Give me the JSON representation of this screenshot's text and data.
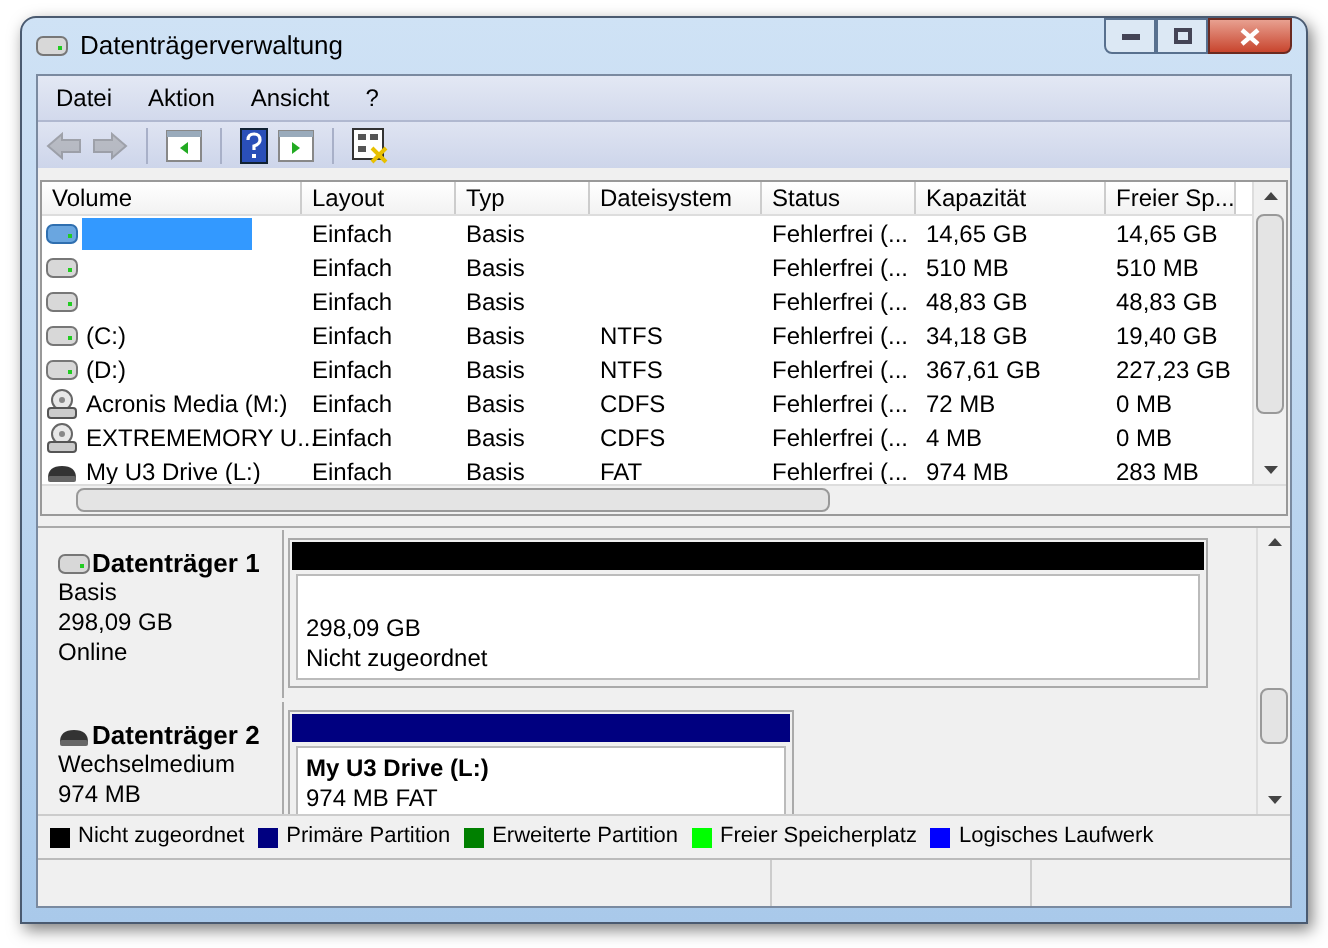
{
  "window": {
    "title": "Datenträgerverwaltung"
  },
  "menu": [
    "Datei",
    "Aktion",
    "Ansicht",
    "?"
  ],
  "toolbar": [
    {
      "kind": "back",
      "disabled": true
    },
    {
      "kind": "forward",
      "disabled": true
    },
    {
      "kind": "sep"
    },
    {
      "kind": "pane"
    },
    {
      "kind": "sep"
    },
    {
      "kind": "help"
    },
    {
      "kind": "pane2"
    },
    {
      "kind": "sep"
    },
    {
      "kind": "props"
    }
  ],
  "table": {
    "columns": [
      "Volume",
      "Layout",
      "Typ",
      "Dateisystem",
      "Status",
      "Kapazität",
      "Freier Sp..."
    ],
    "rows": [
      {
        "kind": "disk",
        "selected": true,
        "cells": [
          "",
          "Einfach",
          "Basis",
          "",
          "Fehlerfrei (...",
          "14,65 GB",
          "14,65 GB"
        ]
      },
      {
        "kind": "disk",
        "selected": false,
        "cells": [
          "",
          "Einfach",
          "Basis",
          "",
          "Fehlerfrei (...",
          "510 MB",
          "510 MB"
        ]
      },
      {
        "kind": "disk",
        "selected": false,
        "cells": [
          "",
          "Einfach",
          "Basis",
          "",
          "Fehlerfrei (...",
          "48,83 GB",
          "48,83 GB"
        ]
      },
      {
        "kind": "disk",
        "selected": false,
        "cells": [
          "(C:)",
          "Einfach",
          "Basis",
          "NTFS",
          "Fehlerfrei (...",
          "34,18 GB",
          "19,40 GB"
        ]
      },
      {
        "kind": "disk",
        "selected": false,
        "cells": [
          "(D:)",
          "Einfach",
          "Basis",
          "NTFS",
          "Fehlerfrei (...",
          "367,61 GB",
          "227,23 GB"
        ]
      },
      {
        "kind": "cd",
        "selected": false,
        "cells": [
          "Acronis Media (M:)",
          "Einfach",
          "Basis",
          "CDFS",
          "Fehlerfrei (...",
          "72 MB",
          "0 MB"
        ]
      },
      {
        "kind": "cd",
        "selected": false,
        "cells": [
          "EXTREMEMORY U...",
          "Einfach",
          "Basis",
          "CDFS",
          "Fehlerfrei (...",
          "4 MB",
          "0 MB"
        ]
      },
      {
        "kind": "removable",
        "selected": false,
        "cells": [
          "My U3 Drive (L:)",
          "Einfach",
          "Basis",
          "FAT",
          "Fehlerfrei (...",
          "974 MB",
          "283 MB"
        ]
      }
    ]
  },
  "disks": [
    {
      "kind": "disk",
      "name": "Datenträger 1",
      "lines": [
        "Basis",
        "298,09 GB",
        "Online"
      ],
      "partitions": [
        {
          "kind": "unallocated",
          "color": "#000000",
          "lines": [
            "298,09 GB",
            "Nicht zugeordnet"
          ]
        }
      ]
    },
    {
      "kind": "removable",
      "name": "Datenträger 2",
      "lines": [
        "Wechselmedium",
        "974 MB"
      ],
      "partitions": [
        {
          "kind": "primary",
          "color": "#000080",
          "title": "My U3 Drive  (L:)",
          "lines": [
            "974 MB FAT"
          ]
        }
      ]
    }
  ],
  "legend": [
    {
      "label": "Nicht zugeordnet",
      "color": "#000000"
    },
    {
      "label": "Primäre Partition",
      "color": "#000080"
    },
    {
      "label": "Erweiterte Partition",
      "color": "#008000"
    },
    {
      "label": "Freier Speicherplatz",
      "color": "#00ff00"
    },
    {
      "label": "Logisches Laufwerk",
      "color": "#0000ff"
    }
  ]
}
